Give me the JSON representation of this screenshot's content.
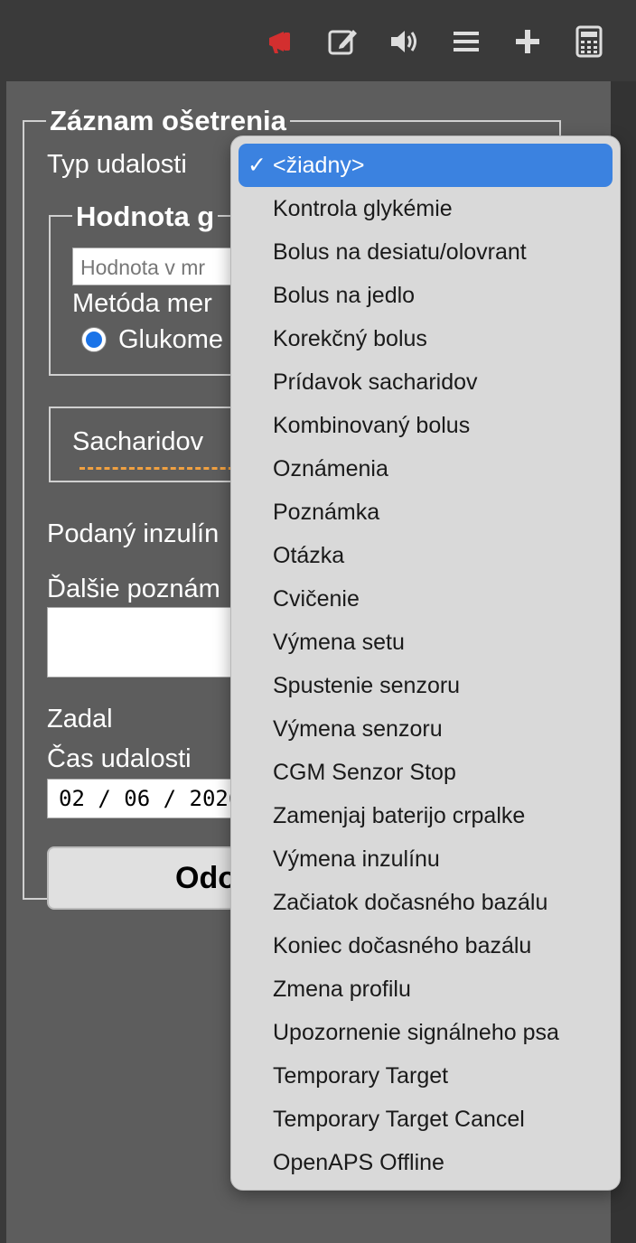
{
  "form": {
    "title": "Záznam ošetrenia",
    "event_type_label": "Typ udalosti",
    "glucose_legend": "Hodnota g",
    "glucose_input_placeholder": "Hodnota v mr",
    "method_label": "Metóda mer",
    "glucometer_option": "Glukome",
    "carbs_label": "Sacharidov",
    "insulin_label": "Podaný inzulín",
    "notes_label": "Ďalšie poznám",
    "entered_by_label": "Zadal",
    "event_time_label": "Čas udalosti",
    "date_value": "02 / 06 / 2026",
    "submit_label": "Odo"
  },
  "dropdown": {
    "selected_index": 0,
    "options": [
      "<žiadny>",
      "Kontrola glykémie",
      "Bolus na desiatu/olovrant",
      "Bolus na jedlo",
      "Korekčný bolus",
      "Prídavok sacharidov",
      "Kombinovaný bolus",
      "Oznámenia",
      "Poznámka",
      "Otázka",
      "Cvičenie",
      "Výmena setu",
      "Spustenie senzoru",
      "Výmena senzoru",
      "CGM Senzor Stop",
      "Zamenjaj baterijo crpalke",
      "Výmena inzulínu",
      "Začiatok dočasného bazálu",
      "Koniec dočasného bazálu",
      "Zmena profilu",
      "Upozornenie signálneho psa",
      "Temporary Target",
      "Temporary Target Cancel",
      "OpenAPS Offline"
    ]
  },
  "toolbar": {
    "icons": [
      "megaphone-icon",
      "edit-icon",
      "volume-icon",
      "menu-icon",
      "plus-icon",
      "calculator-icon"
    ]
  },
  "colors": {
    "accent": "#3b82e0",
    "announcement": "#d32f2f",
    "highlight_arrow": "#f0a040"
  }
}
